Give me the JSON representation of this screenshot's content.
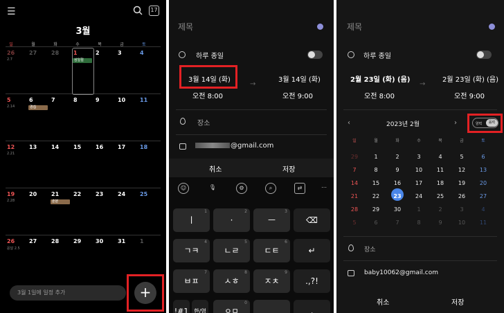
{
  "panel1": {
    "menu_icon": "hamburger-menu-icon",
    "today_badge": "17",
    "month": "3월",
    "weekdays": [
      "일",
      "월",
      "화",
      "수",
      "목",
      "금",
      "토"
    ],
    "weeks": [
      [
        {
          "d": "26",
          "sub": "2.7"
        },
        {
          "d": "27"
        },
        {
          "d": "28"
        },
        {
          "d": "1",
          "ev": "삼일절"
        },
        {
          "d": "2"
        },
        {
          "d": "3"
        },
        {
          "d": "4"
        }
      ],
      [
        {
          "d": "5",
          "sub": "2.14"
        },
        {
          "d": "6",
          "ev": "경칩"
        },
        {
          "d": "7"
        },
        {
          "d": "8"
        },
        {
          "d": "9"
        },
        {
          "d": "10"
        },
        {
          "d": "11"
        }
      ],
      [
        {
          "d": "12",
          "sub": "2.21"
        },
        {
          "d": "13"
        },
        {
          "d": "14"
        },
        {
          "d": "15"
        },
        {
          "d": "16"
        },
        {
          "d": "17"
        },
        {
          "d": "18"
        }
      ],
      [
        {
          "d": "19",
          "sub": "2.28"
        },
        {
          "d": "20"
        },
        {
          "d": "21",
          "ev": "춘분"
        },
        {
          "d": "22"
        },
        {
          "d": "23"
        },
        {
          "d": "24"
        },
        {
          "d": "25"
        }
      ],
      [
        {
          "d": "26",
          "sub": "윤달 2.5"
        },
        {
          "d": "27"
        },
        {
          "d": "28"
        },
        {
          "d": "29"
        },
        {
          "d": "30"
        },
        {
          "d": "31"
        },
        {
          "d": "1"
        }
      ]
    ],
    "add_placeholder": "3월 1일에 일정 추가",
    "fab_label": "+"
  },
  "panel2": {
    "title_placeholder": "제목",
    "allday": "하루 종일",
    "start_date": "3월 14일 (화)",
    "start_time": "오전 8:00",
    "end_date": "3월 14일 (화)",
    "end_time": "오전 9:00",
    "location": "장소",
    "email_suffix": "@gmail.com",
    "cancel": "취소",
    "save": "저장",
    "keys": [
      {
        "label": "ㅣ",
        "sub": "1"
      },
      {
        "label": "·",
        "sub": "2"
      },
      {
        "label": "ㅡ",
        "sub": "3"
      },
      {
        "label": "⌫",
        "sub": ""
      },
      {
        "label": "ㄱㅋ",
        "sub": "4"
      },
      {
        "label": "ㄴㄹ",
        "sub": "5"
      },
      {
        "label": "ㄷㅌ",
        "sub": "6"
      },
      {
        "label": "↵",
        "sub": ""
      },
      {
        "label": "ㅂㅍ",
        "sub": "7"
      },
      {
        "label": "ㅅㅎ",
        "sub": "8"
      },
      {
        "label": "ㅈㅊ",
        "sub": "9"
      },
      {
        "label": ".,?!",
        "sub": ""
      },
      {
        "label": "!#1",
        "sub": ""
      },
      {
        "label": "한/영",
        "sub": ""
      },
      {
        "label": "ㅇㅁ",
        "sub": "0"
      },
      {
        "label": "⎵",
        "sub": ""
      },
      {
        "label": ",",
        "sub": ""
      }
    ]
  },
  "panel3": {
    "title_placeholder": "제목",
    "allday": "하루 종일",
    "start_date": "2월 23일 (화) (음)",
    "start_time": "오전 8:00",
    "end_date": "2월 23일 (화) (음)",
    "end_time": "오전 9:00",
    "year_month": "2023년 2월",
    "seg_solar": "양력",
    "seg_lunar": "음력",
    "weekdays": [
      "일",
      "월",
      "화",
      "수",
      "목",
      "금",
      "토"
    ],
    "grid": [
      [
        "29",
        "1",
        "2",
        "3",
        "4",
        "5",
        "6"
      ],
      [
        "7",
        "8",
        "9",
        "10",
        "11",
        "12",
        "13"
      ],
      [
        "14",
        "15",
        "16",
        "17",
        "18",
        "19",
        "20"
      ],
      [
        "21",
        "22",
        "23",
        "24",
        "25",
        "26",
        "27"
      ],
      [
        "28",
        "29",
        "30",
        "1",
        "2",
        "3",
        "4"
      ],
      [
        "5",
        "6",
        "7",
        "8",
        "9",
        "10",
        "11"
      ]
    ],
    "location": "장소",
    "email": "baby10062@gmail.com",
    "cancel": "취소",
    "save": "저장"
  }
}
